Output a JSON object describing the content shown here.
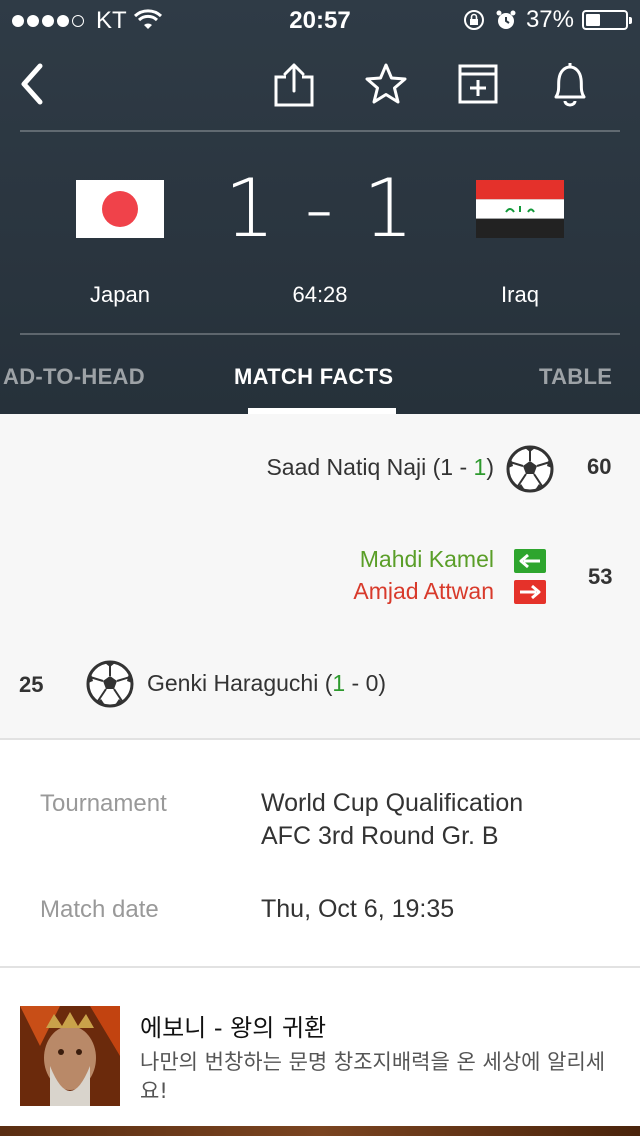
{
  "status_bar": {
    "carrier": "KT",
    "time": "20:57",
    "battery_text": "37%",
    "battery_level": 0.37
  },
  "match": {
    "home": {
      "name": "Japan",
      "flag": "japan-flag"
    },
    "away": {
      "name": "Iraq",
      "flag": "iraq-flag"
    },
    "score": "1 - 1",
    "clock": "64:28"
  },
  "tabs": [
    {
      "label": "AD-TO-HEAD",
      "active": false
    },
    {
      "label": "MATCH FACTS",
      "active": true
    },
    {
      "label": "TABLE",
      "active": false
    }
  ],
  "events": {
    "goal_away": {
      "player": "Saad Natiq Naji",
      "score_open": "(1 - ",
      "score_highlight": "1",
      "score_close": ")",
      "minute": "60"
    },
    "substitution": {
      "player_in": "Mahdi Kamel",
      "player_out": "Amjad Attwan",
      "minute": "53"
    },
    "goal_home": {
      "player": "Genki Haraguchi",
      "score_open": "(",
      "score_highlight": "1",
      "score_close": " - 0)",
      "minute": "25"
    }
  },
  "info": {
    "tournament_label": "Tournament",
    "tournament_line1": "World Cup Qualification",
    "tournament_line2": "AFC 3rd Round Gr. B",
    "date_label": "Match date",
    "date_value": "Thu, Oct 6, 19:35"
  },
  "ad": {
    "title": "에보니 - 왕의 귀환",
    "description": "나만의 번창하는 문명 창조지배력을 온 세상에 알리세요!"
  },
  "colors": {
    "header_bg": "#2c3842",
    "goal_highlight": "#2e9a2e",
    "sub_in": "#5a9e28",
    "sub_out": "#d83a2b"
  }
}
